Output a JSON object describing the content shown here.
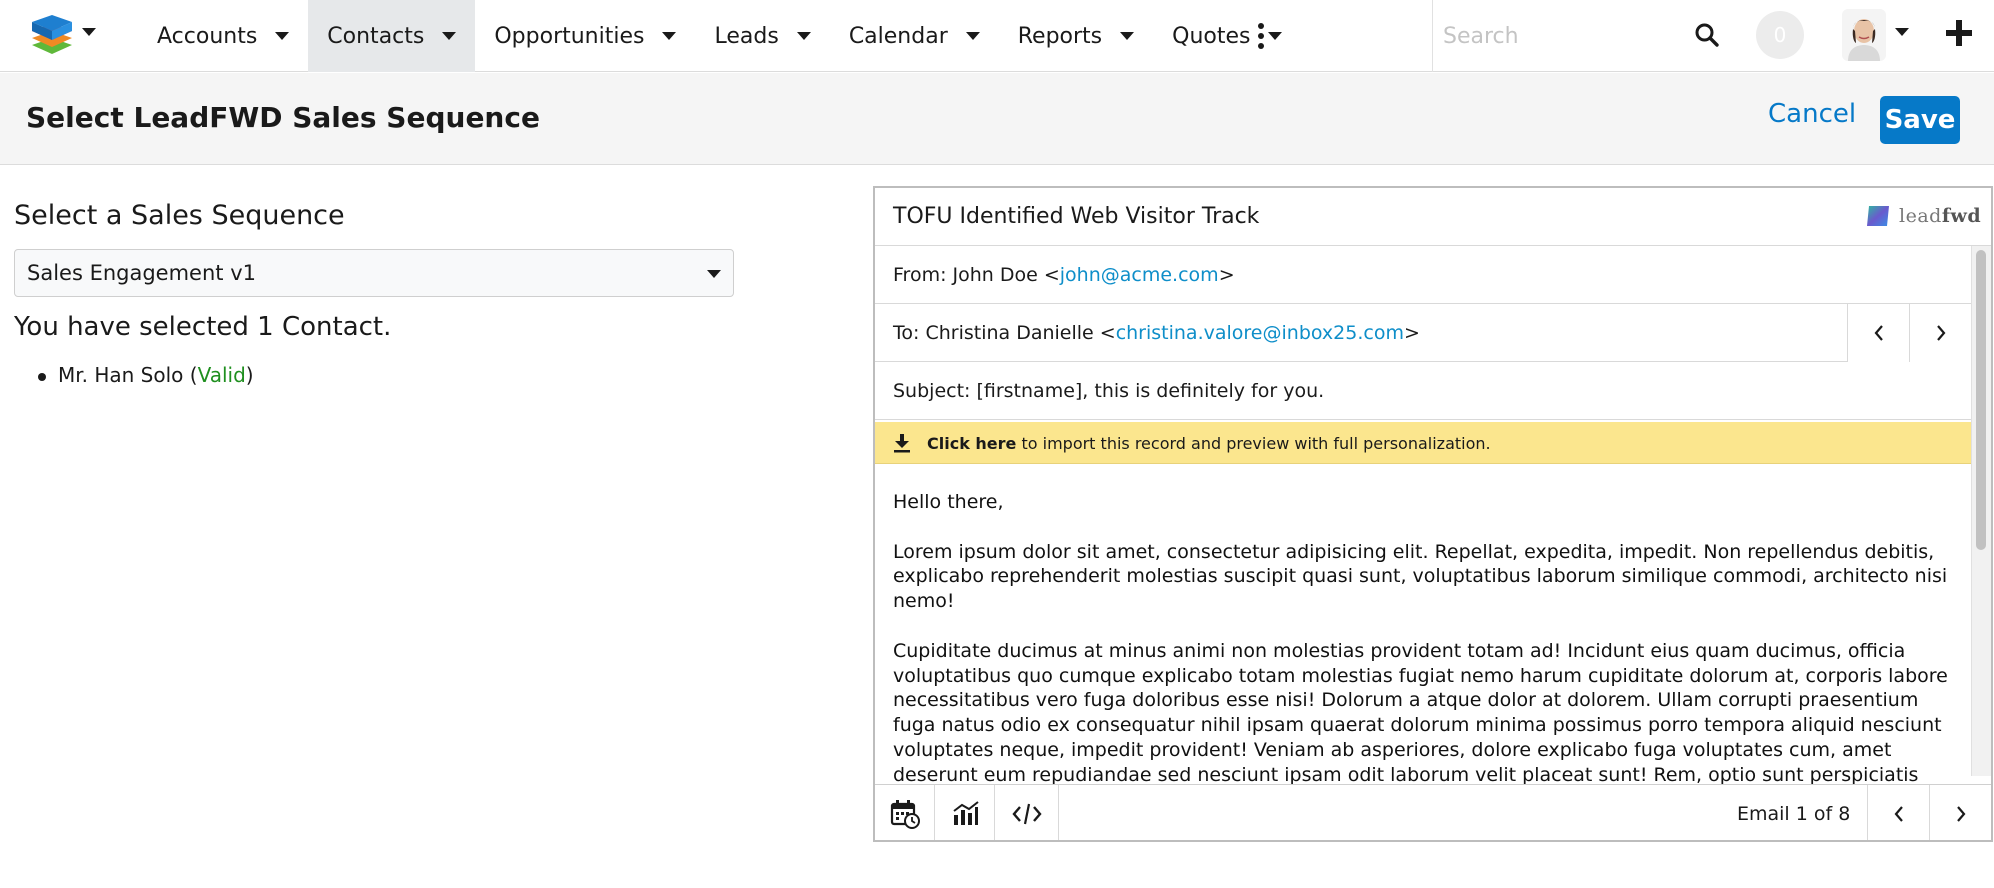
{
  "nav": {
    "items": [
      {
        "label": "Accounts",
        "active": false
      },
      {
        "label": "Contacts",
        "active": true
      },
      {
        "label": "Opportunities",
        "active": false
      },
      {
        "label": "Leads",
        "active": false
      },
      {
        "label": "Calendar",
        "active": false
      },
      {
        "label": "Reports",
        "active": false
      },
      {
        "label": "Quotes",
        "active": false
      }
    ],
    "search_placeholder": "Search",
    "notification_count": "0"
  },
  "header": {
    "title": "Select LeadFWD Sales Sequence",
    "cancel_label": "Cancel",
    "save_label": "Save"
  },
  "left": {
    "select_label": "Select a Sales Sequence",
    "selected_sequence": "Sales Engagement v1",
    "count_text": "You have selected 1 Contact.",
    "contacts": [
      {
        "name": "Mr. Han Solo",
        "status": "Valid"
      }
    ]
  },
  "email": {
    "track_title": "TOFU Identified Web Visitor Track",
    "brand_light": "lead",
    "brand_bold": "fwd",
    "from_prefix": "From: John Doe <",
    "from_email": "john@acme.com",
    "to_prefix": "To: Christina Danielle <",
    "to_email": "christina.valore@inbox25.com",
    "subject": "Subject: [firstname], this is definitely for you.",
    "notice_bold": "Click here",
    "notice_rest": " to import this record and preview with full personalization.",
    "greeting": "Hello there,",
    "paragraph1": "Lorem ipsum dolor sit amet, consectetur adipisicing elit. Repellat, expedita, impedit. Non repellendus debitis, explicabo reprehenderit molestias suscipit quasi sunt, voluptatibus laborum similique commodi, architecto nisi nemo!",
    "paragraph2": "Cupiditate ducimus at minus animi non molestias provident totam ad! Incidunt eius quam ducimus, officia voluptatibus quo cumque explicabo totam molestias fugiat nemo harum cupiditate dolorum at, corporis labore necessitatibus vero fuga doloribus esse nisi! Dolorum a atque dolor at dolorem. Ullam corrupti praesentium fuga natus odio ex consequatur nihil ipsam quaerat dolorum minima possimus porro tempora aliquid nesciunt voluptates neque, impedit provident! Veniam ab asperiores, dolore explicabo fuga voluptates cum, amet deserunt eum repudiandae sed nesciunt ipsam odit laborum velit placeat sunt! Rem, optio sunt perspiciatis obcaecati voluptatibus fugit deserunt dolorum in enim dolore eveniet dolores quam quod itaque dicta sapiente quaerat soluta ex, minima molestias",
    "footer_count": "Email 1 of 8"
  },
  "colors": {
    "accent": "#0679c8",
    "link": "#0e8ec9",
    "valid": "#1f8f1f",
    "notice_bg": "#fbe68e",
    "active_nav_bg": "#e6e8ea"
  }
}
